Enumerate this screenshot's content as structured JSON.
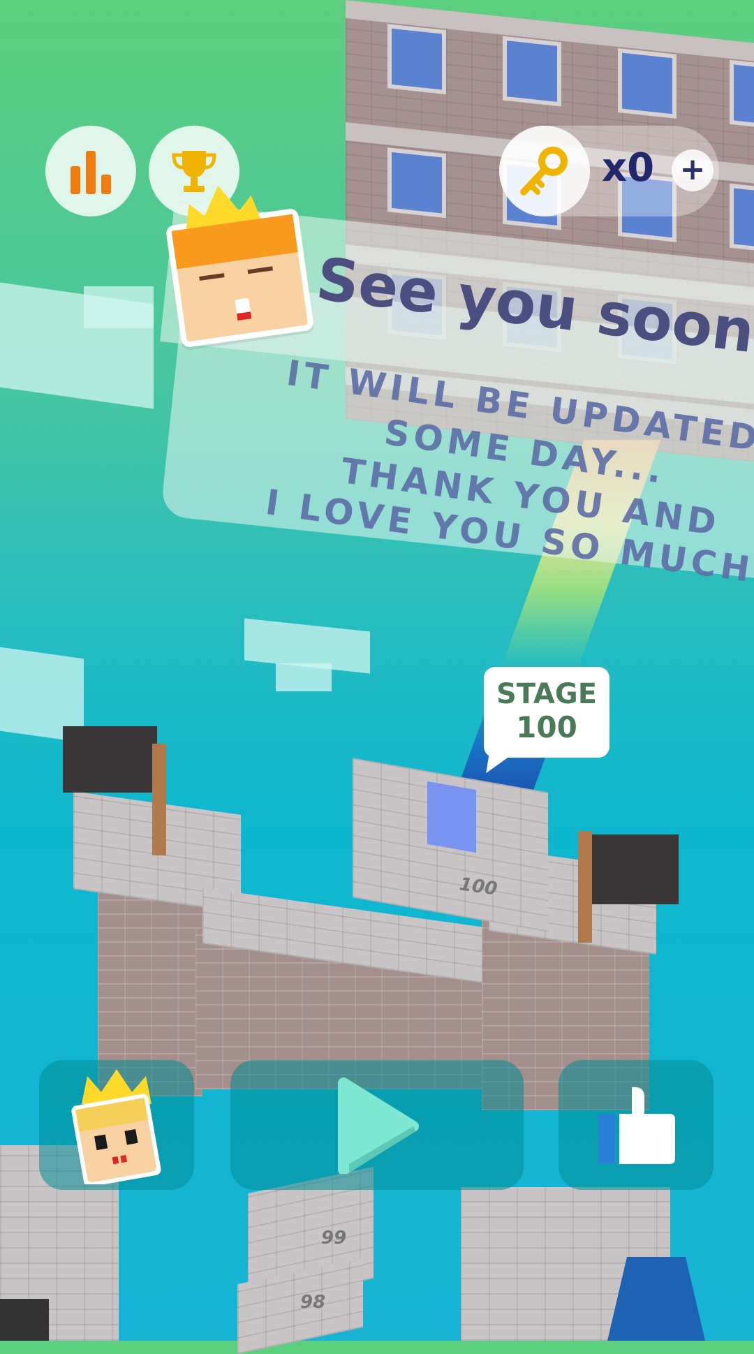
{
  "hud": {
    "stats_icon": "bar-chart-icon",
    "trophy_icon": "trophy-icon",
    "key_icon": "key-icon",
    "key_count": "x0",
    "add_label": "+"
  },
  "message": {
    "title": "See you soon.",
    "lines": [
      "IT WILL BE UPDATED",
      "SOME DAY...",
      "THANK YOU AND",
      "I LOVE YOU SO MUCH."
    ]
  },
  "stage": {
    "label": "STAGE",
    "number": "100"
  },
  "steps": [
    "100",
    "99",
    "98"
  ],
  "bottom": {
    "character_icon": "king-character-icon",
    "play_icon": "play-icon",
    "like_icon": "thumbs-up-icon"
  },
  "colors": {
    "accent_orange": "#f07c10",
    "trophy_gold": "#f0b400",
    "text_navy": "#22266b",
    "play_mint": "#7fe8d2"
  }
}
